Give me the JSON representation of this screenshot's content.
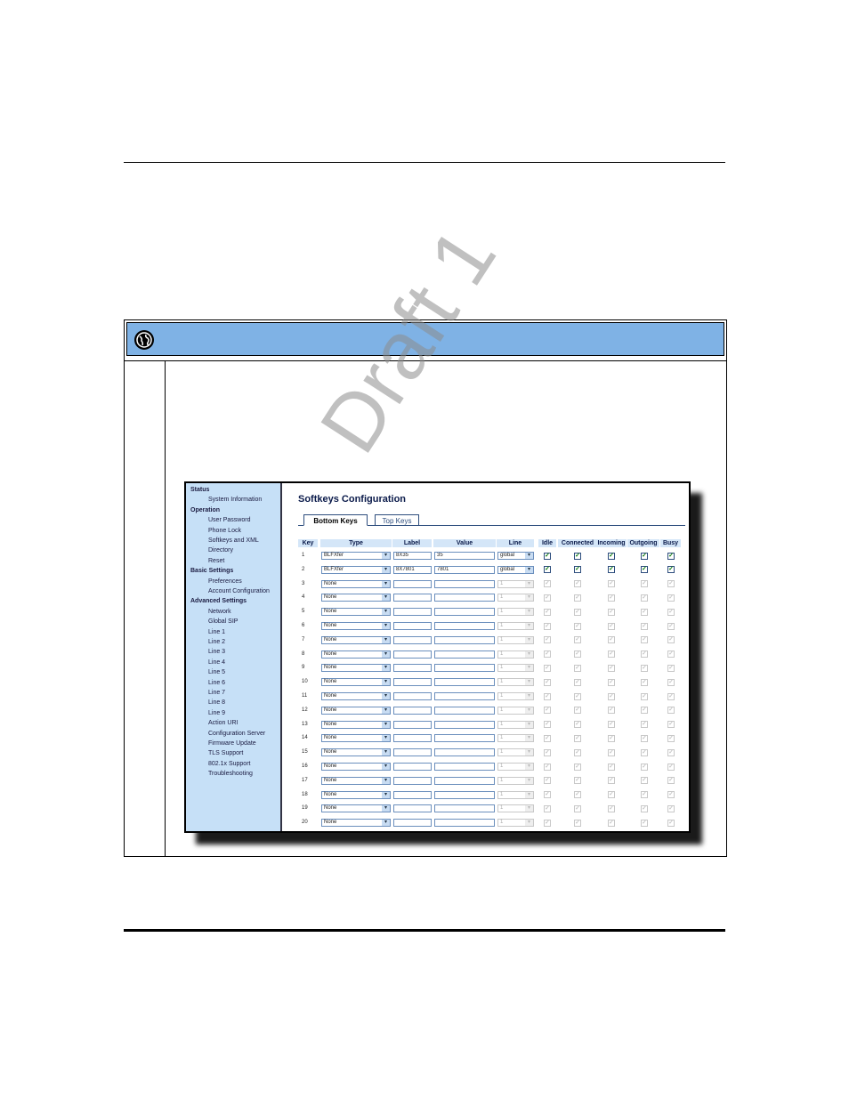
{
  "watermark": "Draft 1",
  "nav": {
    "items": [
      {
        "label": "Status",
        "head": true
      },
      {
        "label": "System Information",
        "head": false
      },
      {
        "label": "Operation",
        "head": true
      },
      {
        "label": "User Password",
        "head": false
      },
      {
        "label": "Phone Lock",
        "head": false
      },
      {
        "label": "Softkeys and XML",
        "head": false
      },
      {
        "label": "Directory",
        "head": false
      },
      {
        "label": "Reset",
        "head": false
      },
      {
        "label": "Basic Settings",
        "head": true
      },
      {
        "label": "Preferences",
        "head": false
      },
      {
        "label": "Account Configuration",
        "head": false
      },
      {
        "label": "Advanced Settings",
        "head": true
      },
      {
        "label": "Network",
        "head": false
      },
      {
        "label": "Global SIP",
        "head": false
      },
      {
        "label": "Line 1",
        "head": false
      },
      {
        "label": "Line 2",
        "head": false
      },
      {
        "label": "Line 3",
        "head": false
      },
      {
        "label": "Line 4",
        "head": false
      },
      {
        "label": "Line 5",
        "head": false
      },
      {
        "label": "Line 6",
        "head": false
      },
      {
        "label": "Line 7",
        "head": false
      },
      {
        "label": "Line 8",
        "head": false
      },
      {
        "label": "Line 9",
        "head": false
      },
      {
        "label": "Action URI",
        "head": false
      },
      {
        "label": "Configuration Server",
        "head": false
      },
      {
        "label": "Firmware Update",
        "head": false
      },
      {
        "label": "TLS Support",
        "head": false
      },
      {
        "label": "802.1x Support",
        "head": false
      },
      {
        "label": "Troubleshooting",
        "head": false
      }
    ]
  },
  "page": {
    "title": "Softkeys Configuration",
    "tabs": [
      "Bottom Keys",
      "Top Keys"
    ]
  },
  "table": {
    "headers": [
      "Key",
      "Type",
      "Label",
      "Value",
      "Line",
      "Idle",
      "Connected",
      "Incoming",
      "Outgoing",
      "Busy"
    ],
    "rows": [
      {
        "key": "1",
        "type": "BLFXfer",
        "label": "8X35",
        "value": "35",
        "line": "global",
        "enabled": true,
        "checks": [
          true,
          true,
          true,
          true,
          true
        ]
      },
      {
        "key": "2",
        "type": "BLFXfer",
        "label": "8X7801",
        "value": "7801",
        "line": "global",
        "enabled": true,
        "checks": [
          true,
          true,
          true,
          true,
          true
        ]
      },
      {
        "key": "3",
        "type": "None",
        "label": "",
        "value": "",
        "line": "1",
        "enabled": false,
        "checks": [
          true,
          true,
          true,
          true,
          true
        ]
      },
      {
        "key": "4",
        "type": "None",
        "label": "",
        "value": "",
        "line": "1",
        "enabled": false,
        "checks": [
          true,
          true,
          true,
          true,
          true
        ]
      },
      {
        "key": "5",
        "type": "None",
        "label": "",
        "value": "",
        "line": "1",
        "enabled": false,
        "checks": [
          true,
          true,
          true,
          true,
          true
        ]
      },
      {
        "key": "6",
        "type": "None",
        "label": "",
        "value": "",
        "line": "1",
        "enabled": false,
        "checks": [
          true,
          true,
          true,
          true,
          true
        ]
      },
      {
        "key": "7",
        "type": "None",
        "label": "",
        "value": "",
        "line": "1",
        "enabled": false,
        "checks": [
          true,
          true,
          true,
          true,
          true
        ]
      },
      {
        "key": "8",
        "type": "None",
        "label": "",
        "value": "",
        "line": "1",
        "enabled": false,
        "checks": [
          true,
          true,
          true,
          true,
          true
        ]
      },
      {
        "key": "9",
        "type": "None",
        "label": "",
        "value": "",
        "line": "1",
        "enabled": false,
        "checks": [
          true,
          true,
          true,
          true,
          true
        ]
      },
      {
        "key": "10",
        "type": "None",
        "label": "",
        "value": "",
        "line": "1",
        "enabled": false,
        "checks": [
          true,
          true,
          true,
          true,
          true
        ]
      },
      {
        "key": "11",
        "type": "None",
        "label": "",
        "value": "",
        "line": "1",
        "enabled": false,
        "checks": [
          true,
          true,
          true,
          true,
          true
        ]
      },
      {
        "key": "12",
        "type": "None",
        "label": "",
        "value": "",
        "line": "1",
        "enabled": false,
        "checks": [
          true,
          true,
          true,
          true,
          true
        ]
      },
      {
        "key": "13",
        "type": "None",
        "label": "",
        "value": "",
        "line": "1",
        "enabled": false,
        "checks": [
          true,
          true,
          true,
          true,
          true
        ]
      },
      {
        "key": "14",
        "type": "None",
        "label": "",
        "value": "",
        "line": "1",
        "enabled": false,
        "checks": [
          true,
          true,
          true,
          true,
          true
        ]
      },
      {
        "key": "15",
        "type": "None",
        "label": "",
        "value": "",
        "line": "1",
        "enabled": false,
        "checks": [
          true,
          true,
          true,
          true,
          true
        ]
      },
      {
        "key": "16",
        "type": "None",
        "label": "",
        "value": "",
        "line": "1",
        "enabled": false,
        "checks": [
          true,
          true,
          true,
          true,
          true
        ]
      },
      {
        "key": "17",
        "type": "None",
        "label": "",
        "value": "",
        "line": "1",
        "enabled": false,
        "checks": [
          true,
          true,
          true,
          true,
          true
        ]
      },
      {
        "key": "18",
        "type": "None",
        "label": "",
        "value": "",
        "line": "1",
        "enabled": false,
        "checks": [
          true,
          true,
          true,
          true,
          true
        ]
      },
      {
        "key": "19",
        "type": "None",
        "label": "",
        "value": "",
        "line": "1",
        "enabled": false,
        "checks": [
          true,
          true,
          true,
          true,
          true
        ]
      },
      {
        "key": "20",
        "type": "None",
        "label": "",
        "value": "",
        "line": "1",
        "enabled": false,
        "checks": [
          true,
          true,
          true,
          true,
          true
        ]
      }
    ]
  },
  "colors": {
    "banner": "#7fb2e5",
    "nav_bg": "#c6e0f7",
    "header_bg": "#d4e6f8"
  },
  "icons": {
    "banner": "globe-icon",
    "select_arrow": "chevron-down-icon",
    "checkbox": "check-icon"
  }
}
